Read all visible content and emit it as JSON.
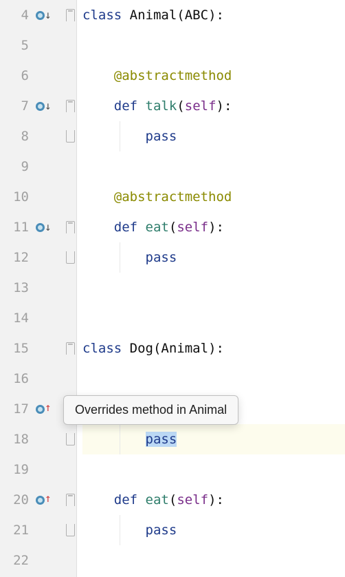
{
  "tooltip": "Overrides method in Animal",
  "lines": [
    {
      "num": 4,
      "override": "down",
      "fold": "start",
      "tokens": [
        {
          "t": "class ",
          "c": "tk-keyword"
        },
        {
          "t": "Animal",
          "c": "tk-class"
        },
        {
          "t": "(",
          "c": "tk-punct"
        },
        {
          "t": "ABC",
          "c": "tk-class"
        },
        {
          "t": "):",
          "c": "tk-punct"
        }
      ],
      "indent": 0
    },
    {
      "num": 5,
      "tokens": [],
      "indent": 0
    },
    {
      "num": 6,
      "tokens": [
        {
          "t": "@abstractmethod",
          "c": "tk-decorator"
        }
      ],
      "indent": 1
    },
    {
      "num": 7,
      "override": "down",
      "fold": "start",
      "tokens": [
        {
          "t": "def ",
          "c": "tk-def"
        },
        {
          "t": "talk",
          "c": "tk-func"
        },
        {
          "t": "(",
          "c": "tk-punct"
        },
        {
          "t": "self",
          "c": "tk-self"
        },
        {
          "t": "):",
          "c": "tk-punct"
        }
      ],
      "indent": 1
    },
    {
      "num": 8,
      "fold": "end",
      "tokens": [
        {
          "t": "pass",
          "c": "tk-pass"
        }
      ],
      "indent": 2
    },
    {
      "num": 9,
      "tokens": [],
      "indent": 0
    },
    {
      "num": 10,
      "tokens": [
        {
          "t": "@abstractmethod",
          "c": "tk-decorator"
        }
      ],
      "indent": 1
    },
    {
      "num": 11,
      "override": "down",
      "fold": "start",
      "tokens": [
        {
          "t": "def ",
          "c": "tk-def"
        },
        {
          "t": "eat",
          "c": "tk-func"
        },
        {
          "t": "(",
          "c": "tk-punct"
        },
        {
          "t": "self",
          "c": "tk-self"
        },
        {
          "t": "):",
          "c": "tk-punct"
        }
      ],
      "indent": 1
    },
    {
      "num": 12,
      "fold": "end",
      "tokens": [
        {
          "t": "pass",
          "c": "tk-pass"
        }
      ],
      "indent": 2
    },
    {
      "num": 13,
      "tokens": [],
      "indent": 0
    },
    {
      "num": 14,
      "tokens": [],
      "indent": 0
    },
    {
      "num": 15,
      "fold": "start",
      "tokens": [
        {
          "t": "class ",
          "c": "tk-keyword"
        },
        {
          "t": "Dog",
          "c": "tk-class"
        },
        {
          "t": "(",
          "c": "tk-punct"
        },
        {
          "t": "Animal",
          "c": "tk-class"
        },
        {
          "t": "):",
          "c": "tk-punct"
        }
      ],
      "indent": 0
    },
    {
      "num": 16,
      "tokens": [],
      "indent": 0
    },
    {
      "num": 17,
      "override": "up",
      "tokens": [],
      "indent": 1
    },
    {
      "num": 18,
      "fold": "end",
      "tokens": [
        {
          "t": "pass",
          "c": "tk-pass",
          "sel": true
        }
      ],
      "indent": 2,
      "hl": true
    },
    {
      "num": 19,
      "tokens": [],
      "indent": 0
    },
    {
      "num": 20,
      "override": "up",
      "fold": "start",
      "tokens": [
        {
          "t": "def ",
          "c": "tk-def"
        },
        {
          "t": "eat",
          "c": "tk-func"
        },
        {
          "t": "(",
          "c": "tk-punct"
        },
        {
          "t": "self",
          "c": "tk-self"
        },
        {
          "t": "):",
          "c": "tk-punct"
        }
      ],
      "indent": 1
    },
    {
      "num": 21,
      "fold": "end",
      "tokens": [
        {
          "t": "pass",
          "c": "tk-pass"
        }
      ],
      "indent": 2
    },
    {
      "num": 22,
      "tokens": [],
      "indent": 0
    }
  ]
}
